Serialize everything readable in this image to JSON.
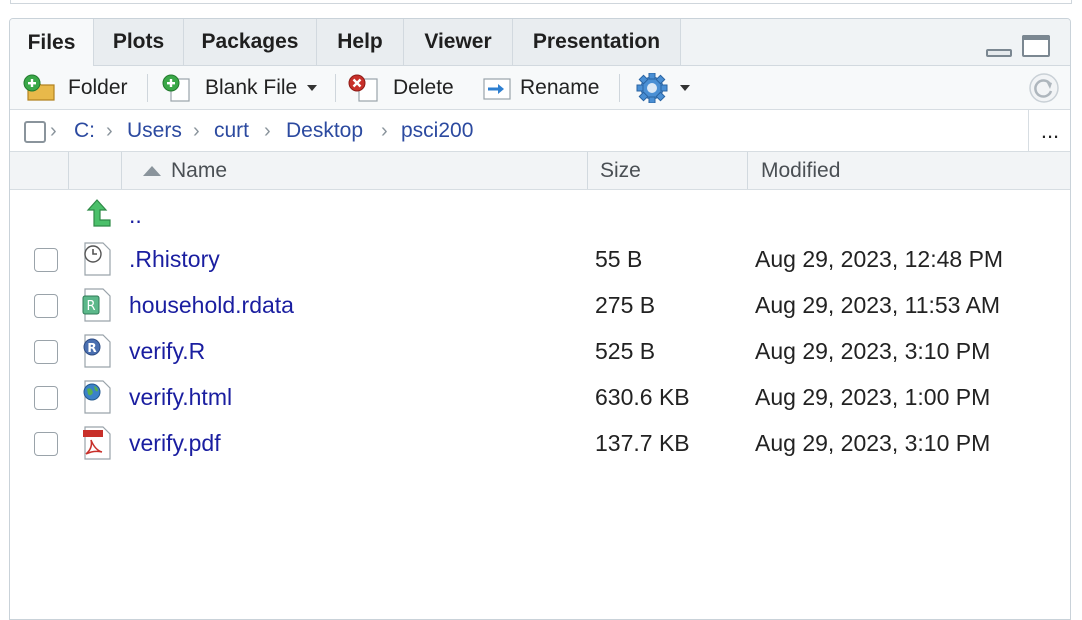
{
  "tabs": [
    {
      "label": "Files"
    },
    {
      "label": "Plots"
    },
    {
      "label": "Packages"
    },
    {
      "label": "Help"
    },
    {
      "label": "Viewer"
    },
    {
      "label": "Presentation"
    }
  ],
  "toolbar": {
    "new_folder_label": "Folder",
    "blank_file_label": "Blank File",
    "delete_label": "Delete",
    "rename_label": "Rename"
  },
  "breadcrumb": {
    "items": [
      "C:",
      "Users",
      "curt",
      "Desktop",
      "psci200"
    ],
    "more_label": "..."
  },
  "table": {
    "columns": {
      "name": "Name",
      "size": "Size",
      "modified": "Modified"
    },
    "parent_label": "..",
    "rows": [
      {
        "name": ".Rhistory",
        "size": "55 B",
        "modified": "Aug 29, 2023, 12:48 PM",
        "icon": "history-file-icon"
      },
      {
        "name": "household.rdata",
        "size": "275 B",
        "modified": "Aug 29, 2023, 11:53 AM",
        "icon": "rdata-file-icon"
      },
      {
        "name": "verify.R",
        "size": "525 B",
        "modified": "Aug 29, 2023, 3:10 PM",
        "icon": "r-script-icon"
      },
      {
        "name": "verify.html",
        "size": "630.6 KB",
        "modified": "Aug 29, 2023, 1:00 PM",
        "icon": "html-file-icon"
      },
      {
        "name": "verify.pdf",
        "size": "137.7 KB",
        "modified": "Aug 29, 2023, 3:10 PM",
        "icon": "pdf-file-icon"
      }
    ]
  },
  "colors": {
    "link": "#1a1ea0",
    "crumb": "#2c4aa0",
    "tab_bg": "#e9edf0",
    "toolbar_bg": "#f7f9fa"
  }
}
